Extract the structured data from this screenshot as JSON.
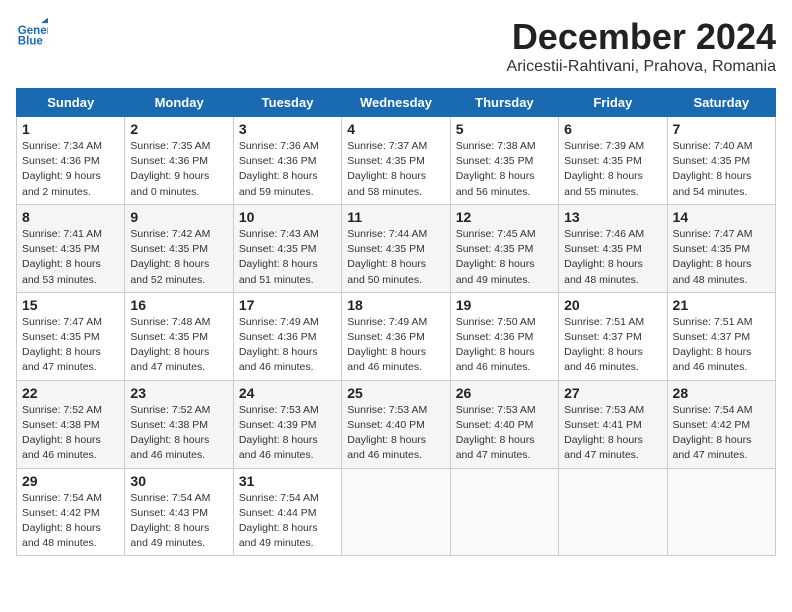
{
  "header": {
    "logo_line1": "General",
    "logo_line2": "Blue",
    "month_title": "December 2024",
    "subtitle": "Aricestii-Rahtivani, Prahova, Romania"
  },
  "days_of_week": [
    "Sunday",
    "Monday",
    "Tuesday",
    "Wednesday",
    "Thursday",
    "Friday",
    "Saturday"
  ],
  "weeks": [
    [
      {
        "day": 1,
        "sunrise": "7:34 AM",
        "sunset": "4:36 PM",
        "daylight": "9 hours and 2 minutes."
      },
      {
        "day": 2,
        "sunrise": "7:35 AM",
        "sunset": "4:36 PM",
        "daylight": "9 hours and 0 minutes."
      },
      {
        "day": 3,
        "sunrise": "7:36 AM",
        "sunset": "4:36 PM",
        "daylight": "8 hours and 59 minutes."
      },
      {
        "day": 4,
        "sunrise": "7:37 AM",
        "sunset": "4:35 PM",
        "daylight": "8 hours and 58 minutes."
      },
      {
        "day": 5,
        "sunrise": "7:38 AM",
        "sunset": "4:35 PM",
        "daylight": "8 hours and 56 minutes."
      },
      {
        "day": 6,
        "sunrise": "7:39 AM",
        "sunset": "4:35 PM",
        "daylight": "8 hours and 55 minutes."
      },
      {
        "day": 7,
        "sunrise": "7:40 AM",
        "sunset": "4:35 PM",
        "daylight": "8 hours and 54 minutes."
      }
    ],
    [
      {
        "day": 8,
        "sunrise": "7:41 AM",
        "sunset": "4:35 PM",
        "daylight": "8 hours and 53 minutes."
      },
      {
        "day": 9,
        "sunrise": "7:42 AM",
        "sunset": "4:35 PM",
        "daylight": "8 hours and 52 minutes."
      },
      {
        "day": 10,
        "sunrise": "7:43 AM",
        "sunset": "4:35 PM",
        "daylight": "8 hours and 51 minutes."
      },
      {
        "day": 11,
        "sunrise": "7:44 AM",
        "sunset": "4:35 PM",
        "daylight": "8 hours and 50 minutes."
      },
      {
        "day": 12,
        "sunrise": "7:45 AM",
        "sunset": "4:35 PM",
        "daylight": "8 hours and 49 minutes."
      },
      {
        "day": 13,
        "sunrise": "7:46 AM",
        "sunset": "4:35 PM",
        "daylight": "8 hours and 48 minutes."
      },
      {
        "day": 14,
        "sunrise": "7:47 AM",
        "sunset": "4:35 PM",
        "daylight": "8 hours and 48 minutes."
      }
    ],
    [
      {
        "day": 15,
        "sunrise": "7:47 AM",
        "sunset": "4:35 PM",
        "daylight": "8 hours and 47 minutes."
      },
      {
        "day": 16,
        "sunrise": "7:48 AM",
        "sunset": "4:35 PM",
        "daylight": "8 hours and 47 minutes."
      },
      {
        "day": 17,
        "sunrise": "7:49 AM",
        "sunset": "4:36 PM",
        "daylight": "8 hours and 46 minutes."
      },
      {
        "day": 18,
        "sunrise": "7:49 AM",
        "sunset": "4:36 PM",
        "daylight": "8 hours and 46 minutes."
      },
      {
        "day": 19,
        "sunrise": "7:50 AM",
        "sunset": "4:36 PM",
        "daylight": "8 hours and 46 minutes."
      },
      {
        "day": 20,
        "sunrise": "7:51 AM",
        "sunset": "4:37 PM",
        "daylight": "8 hours and 46 minutes."
      },
      {
        "day": 21,
        "sunrise": "7:51 AM",
        "sunset": "4:37 PM",
        "daylight": "8 hours and 46 minutes."
      }
    ],
    [
      {
        "day": 22,
        "sunrise": "7:52 AM",
        "sunset": "4:38 PM",
        "daylight": "8 hours and 46 minutes."
      },
      {
        "day": 23,
        "sunrise": "7:52 AM",
        "sunset": "4:38 PM",
        "daylight": "8 hours and 46 minutes."
      },
      {
        "day": 24,
        "sunrise": "7:53 AM",
        "sunset": "4:39 PM",
        "daylight": "8 hours and 46 minutes."
      },
      {
        "day": 25,
        "sunrise": "7:53 AM",
        "sunset": "4:40 PM",
        "daylight": "8 hours and 46 minutes."
      },
      {
        "day": 26,
        "sunrise": "7:53 AM",
        "sunset": "4:40 PM",
        "daylight": "8 hours and 47 minutes."
      },
      {
        "day": 27,
        "sunrise": "7:53 AM",
        "sunset": "4:41 PM",
        "daylight": "8 hours and 47 minutes."
      },
      {
        "day": 28,
        "sunrise": "7:54 AM",
        "sunset": "4:42 PM",
        "daylight": "8 hours and 47 minutes."
      }
    ],
    [
      {
        "day": 29,
        "sunrise": "7:54 AM",
        "sunset": "4:42 PM",
        "daylight": "8 hours and 48 minutes."
      },
      {
        "day": 30,
        "sunrise": "7:54 AM",
        "sunset": "4:43 PM",
        "daylight": "8 hours and 49 minutes."
      },
      {
        "day": 31,
        "sunrise": "7:54 AM",
        "sunset": "4:44 PM",
        "daylight": "8 hours and 49 minutes."
      },
      null,
      null,
      null,
      null
    ]
  ]
}
